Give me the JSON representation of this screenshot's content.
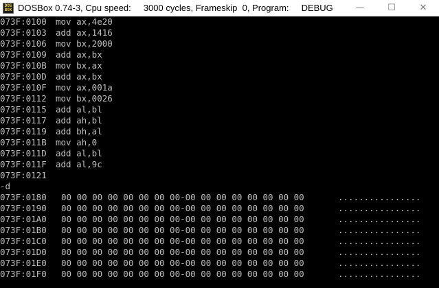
{
  "window": {
    "icon_text": "DOS BOX",
    "title": "DOSBox 0.74-3, Cpu speed:     3000 cycles, Frameskip  0, Program:     DEBUG",
    "minimize_glyph": "—",
    "maximize_glyph": "☐",
    "close_glyph": "✕"
  },
  "console": {
    "disassembly": [
      {
        "addr": "073F:0100",
        "asm": "mov ax,4e20"
      },
      {
        "addr": "073F:0103",
        "asm": "add ax,1416"
      },
      {
        "addr": "073F:0106",
        "asm": "mov bx,2000"
      },
      {
        "addr": "073F:0109",
        "asm": "add ax,bx"
      },
      {
        "addr": "073F:010B",
        "asm": "mov bx,ax"
      },
      {
        "addr": "073F:010D",
        "asm": "add ax,bx"
      },
      {
        "addr": "073F:010F",
        "asm": "mov ax,001a"
      },
      {
        "addr": "073F:0112",
        "asm": "mov bx,0026"
      },
      {
        "addr": "073F:0115",
        "asm": "add al,bl"
      },
      {
        "addr": "073F:0117",
        "asm": "add ah,bl"
      },
      {
        "addr": "073F:0119",
        "asm": "add bh,al"
      },
      {
        "addr": "073F:011B",
        "asm": "mov ah,0"
      },
      {
        "addr": "073F:011D",
        "asm": "add al,bl"
      },
      {
        "addr": "073F:011F",
        "asm": "add al,9c"
      }
    ],
    "prompt_address": "073F:0121",
    "command": "-d",
    "dump": [
      {
        "addr": "073F:0180",
        "bytes": "00 00 00 00 00 00 00 00-00 00 00 00 00 00 00 00",
        "ascii": "................"
      },
      {
        "addr": "073F:0190",
        "bytes": "00 00 00 00 00 00 00 00-00 00 00 00 00 00 00 00",
        "ascii": "................"
      },
      {
        "addr": "073F:01A0",
        "bytes": "00 00 00 00 00 00 00 00-00 00 00 00 00 00 00 00",
        "ascii": "................"
      },
      {
        "addr": "073F:01B0",
        "bytes": "00 00 00 00 00 00 00 00-00 00 00 00 00 00 00 00",
        "ascii": "................"
      },
      {
        "addr": "073F:01C0",
        "bytes": "00 00 00 00 00 00 00 00-00 00 00 00 00 00 00 00",
        "ascii": "................"
      },
      {
        "addr": "073F:01D0",
        "bytes": "00 00 00 00 00 00 00 00-00 00 00 00 00 00 00 00",
        "ascii": "................"
      },
      {
        "addr": "073F:01E0",
        "bytes": "00 00 00 00 00 00 00 00-00 00 00 00 00 00 00 00",
        "ascii": "................"
      },
      {
        "addr": "073F:01F0",
        "bytes": "00 00 00 00 00 00 00 00-00 00 00 00 00 00 00 00",
        "ascii": "................"
      }
    ]
  },
  "colors": {
    "console_bg": "#000000",
    "console_text": "#c0c0c0",
    "titlebar_bg": "#ffffff"
  }
}
